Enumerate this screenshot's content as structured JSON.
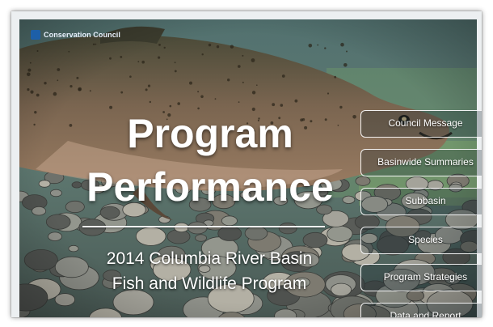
{
  "brand": {
    "name": "Conservation Council"
  },
  "hero": {
    "title_line1": "Program",
    "title_line2": "Performance",
    "subtitle_line1": "2014 Columbia River Basin",
    "subtitle_line2": "Fish and Wildlife Program"
  },
  "menu": {
    "items": [
      {
        "label": "Council Message"
      },
      {
        "label": "Basinwide Summaries"
      },
      {
        "label": "Subbasin"
      },
      {
        "label": "Species"
      },
      {
        "label": "Program Strategies"
      },
      {
        "label": "Data and Report"
      }
    ]
  },
  "colors": {
    "water": "#4f6f70",
    "fish_body": "#6e5d48",
    "pebbles": "#6b6e6a",
    "logo": "#1d5fa8"
  }
}
